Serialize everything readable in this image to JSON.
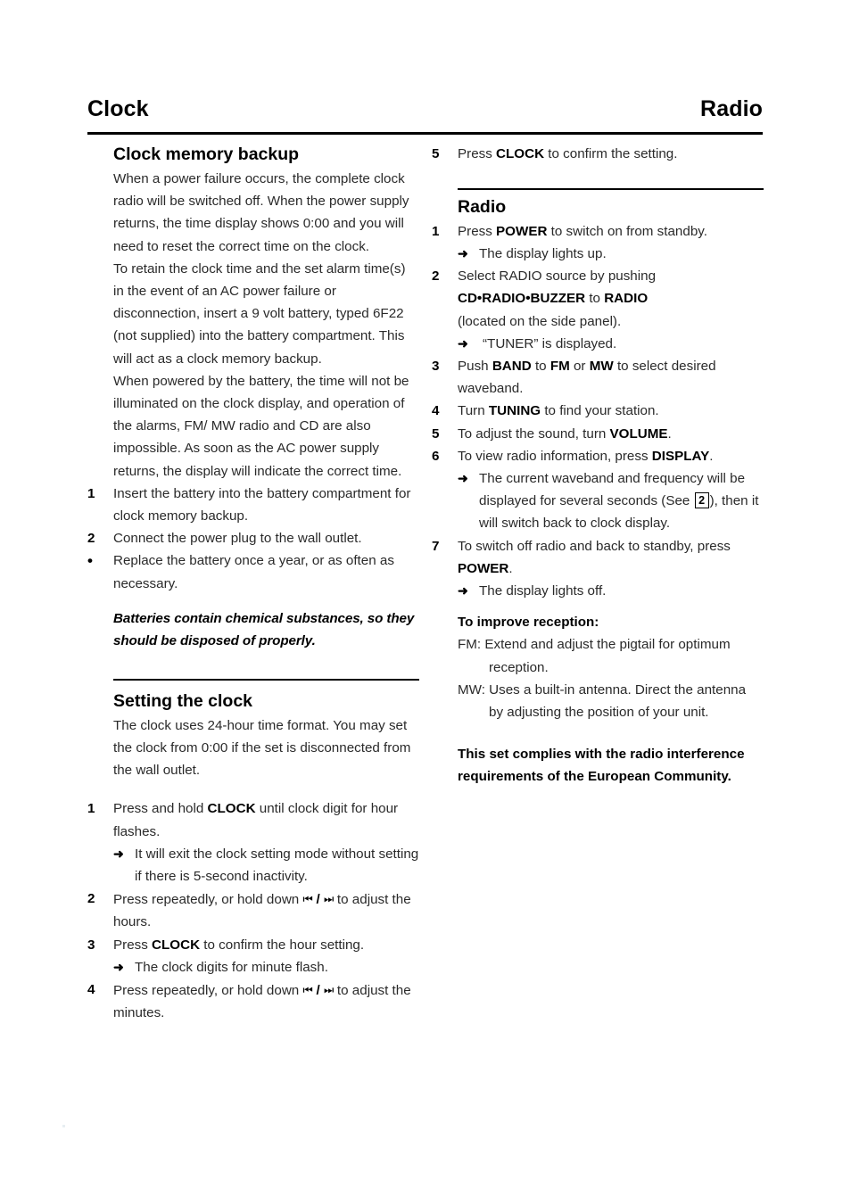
{
  "running_head": {
    "left_title": "Clock",
    "right_title": "Radio"
  },
  "left_column": {
    "section1": {
      "heading": "Clock memory backup",
      "paragraphs": [
        "When a power failure occurs, the complete clock radio will be switched off. When the power supply returns, the time display shows 0:00 and you will need to reset the correct time on the clock.",
        "To retain the clock time and the set alarm time(s) in the event of an AC power failure or disconnection, insert a 9 volt battery, typed 6F22 (not supplied) into the battery compartment. This will act as a clock memory backup.",
        "When powered by the battery, the time will not be illuminated on the clock display, and operation of the alarms, FM/ MW radio and CD are also impossible. As soon as the AC power supply returns, the display will indicate the correct time."
      ],
      "steps": [
        {
          "marker": "1",
          "text": "Insert the battery into the battery compartment for clock memory backup."
        },
        {
          "marker": "2",
          "text": "Connect the power plug to the wall outlet."
        },
        {
          "marker": "•",
          "text": "Replace the battery once a year, or as often as necessary."
        }
      ],
      "warning": "Batteries contain chemical substances, so they should be disposed of properly."
    },
    "section2": {
      "heading": "Setting the clock",
      "intro": "The clock uses 24-hour time format. You may set the clock from 0:00 if the set is disconnected from the wall outlet.",
      "step1": {
        "marker": "1",
        "text_before": "Press and hold ",
        "bold": "CLOCK",
        "text_after": " until clock digit for hour flashes.",
        "result": "It will exit the clock setting mode without setting if there is 5-second inactivity."
      },
      "step2": {
        "marker": "2",
        "text_before": "Press repeatedly, or hold down ",
        "glyph_prev": "⏮",
        "glyph_sep": "/",
        "glyph_next": "⏭",
        "text_after": " to adjust the hours."
      },
      "step3": {
        "marker": "3",
        "text_before": "Press ",
        "bold": "CLOCK",
        "text_after": " to confirm the hour setting.",
        "result": "The clock digits for minute flash."
      },
      "step4": {
        "marker": "4",
        "text_before": "Press repeatedly, or hold down ",
        "glyph_prev": "⏮",
        "glyph_sep": "/",
        "glyph_next": "⏭",
        "text_after": " to adjust the minutes."
      }
    }
  },
  "right_column": {
    "step5": {
      "marker": "5",
      "text_before": "Press ",
      "bold": "CLOCK",
      "text_after": " to confirm the setting."
    },
    "radio_section": {
      "heading": "Radio",
      "step1": {
        "marker": "1",
        "text_before": "Press ",
        "bold": "POWER",
        "text_after": " to switch on from standby.",
        "result": "The display lights up."
      },
      "step2": {
        "marker": "2",
        "line1": "Select RADIO source by pushing",
        "bold1": "CD•RADIO•BUZZER",
        "mid": " to ",
        "bold2": "RADIO",
        "line3": "(located on the side panel).",
        "result": "“TUNER” is displayed."
      },
      "step3": {
        "marker": "3",
        "t1": "Push ",
        "b1": "BAND",
        "t2": " to ",
        "b2": "FM",
        "t3": " or ",
        "b3": "MW",
        "t4": " to select desired waveband."
      },
      "step4": {
        "marker": "4",
        "t1": "Turn ",
        "b1": "TUNING",
        "t2": " to find your station."
      },
      "step5b": {
        "marker": "5",
        "t1": "To adjust the sound, turn ",
        "b1": "VOLUME",
        "t2": "."
      },
      "step6": {
        "marker": "6",
        "t1": "To view radio information, press ",
        "b1": "DISPLAY",
        "t2": ".",
        "result_a": "The current waveband and frequency will be displayed for several seconds (See ",
        "result_box": "2",
        "result_b": "), then it will switch back to clock display."
      },
      "step7": {
        "marker": "7",
        "t1": "To switch off radio and back to standby, press ",
        "b1": "POWER",
        "t2": ".",
        "result": "The display lights off."
      },
      "reception": {
        "heading": "To improve reception:",
        "fm": "FM: Extend and adjust the pigtail for optimum reception.",
        "mw": "MW: Uses a built-in antenna. Direct the antenna by adjusting the position of your unit."
      },
      "compliance": "This set complies with the radio interference requirements of the European Community."
    }
  },
  "icons": {
    "arrow": "➜"
  }
}
